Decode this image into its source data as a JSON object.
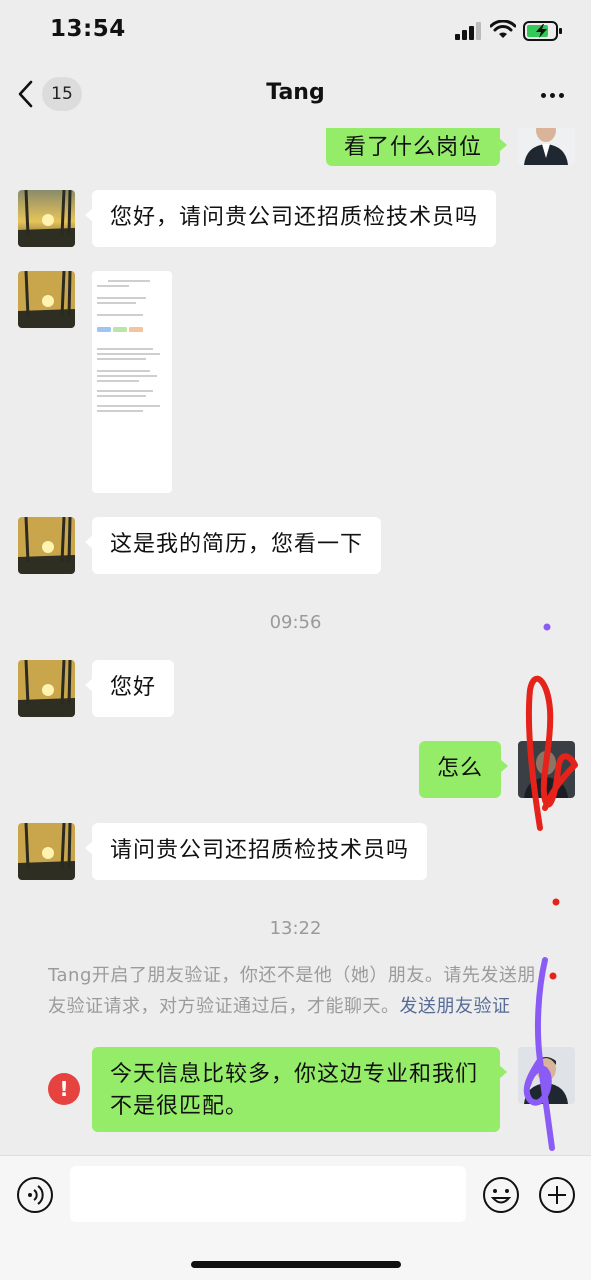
{
  "status_bar": {
    "time": "13:54"
  },
  "nav": {
    "unread_count": "15",
    "title": "Tang"
  },
  "messages": {
    "m0_sent": "看了什么岗位",
    "m1_received": "您好，请问贵公司还招质检技术员吗",
    "m3_received": "这是我的简历，您看一下",
    "ts1": "09:56",
    "m4_received": "您好",
    "m5_sent": "怎么",
    "m6_received": "请问贵公司还招质检技术员吗",
    "ts2": "13:22",
    "system_notice": "Tang开启了朋友验证，你还不是他（她）朋友。请先发送朋友验证请求，对方验证通过后，才能聊天。",
    "system_link": "发送朋友验证",
    "m7_sent_failed": "今天信息比较多，你这边专业和我们不是很匹配。",
    "error_mark": "!"
  },
  "icons": {
    "back": "chevron-left-icon",
    "more": "more-dots-icon",
    "voice": "voice-icon",
    "emoji": "emoji-icon",
    "plus": "plus-icon",
    "error": "error-icon"
  },
  "colors": {
    "sent_bubble": "#95ec69",
    "received_bubble": "#ffffff",
    "chat_background": "#ededed",
    "link": "#576b95",
    "error": "#e64340",
    "annotation_red": "#e5231b",
    "annotation_purple": "#8a5cf5"
  }
}
